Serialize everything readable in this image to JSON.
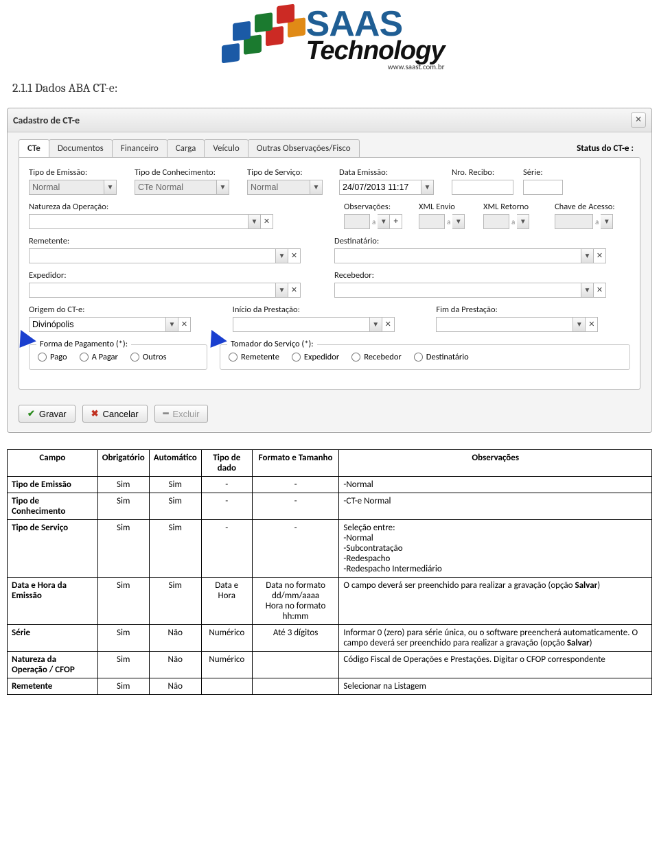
{
  "logo": {
    "saas": "SAAS",
    "tech": "Technology",
    "url": "www.saast.com.br"
  },
  "section_heading": "2.1.1 Dados ABA CT-e:",
  "window": {
    "title": "Cadastro de CT-e",
    "status_label": "Status do CT-e :",
    "tabs": [
      {
        "label": "CTe",
        "active": true
      },
      {
        "label": "Documentos",
        "active": false
      },
      {
        "label": "Financeiro",
        "active": false
      },
      {
        "label": "Carga",
        "active": false
      },
      {
        "label": "Veículo",
        "active": false
      },
      {
        "label": "Outras Observações/Fisco",
        "active": false
      }
    ],
    "row1": {
      "tipo_emissao": {
        "label": "Tipo de Emissão:",
        "value": "Normal"
      },
      "tipo_conhecimento": {
        "label": "Tipo de Conhecimento:",
        "value": "CTe Normal"
      },
      "tipo_servico": {
        "label": "Tipo de Serviço:",
        "value": "Normal"
      },
      "data_emissao": {
        "label": "Data Emissão:",
        "value": "24/07/2013 11:17"
      },
      "nro_recibo": {
        "label": "Nro. Recibo:",
        "value": ""
      },
      "serie": {
        "label": "Série:",
        "value": ""
      }
    },
    "row2": {
      "natureza": {
        "label": "Natureza da Operação:",
        "value": ""
      },
      "observacoes": {
        "label": "Observações:",
        "value": ""
      },
      "xml_envio": {
        "label": "XML Envio",
        "value": ""
      },
      "xml_retorno": {
        "label": "XML Retorno",
        "value": ""
      },
      "chave_acesso": {
        "label": "Chave de Acesso:",
        "value": ""
      }
    },
    "row3": {
      "remetente": {
        "label": "Remetente:",
        "value": ""
      },
      "destinatario": {
        "label": "Destinatário:",
        "value": ""
      }
    },
    "row4": {
      "expedidor": {
        "label": "Expedidor:",
        "value": ""
      },
      "recebedor": {
        "label": "Recebedor:",
        "value": ""
      }
    },
    "row5": {
      "origem": {
        "label": "Origem do CT-e:",
        "value": "Divinópolis"
      },
      "inicio": {
        "label": "Início da Prestação:",
        "value": ""
      },
      "fim": {
        "label": "Fim da Prestação:",
        "value": ""
      }
    },
    "group_pagamento": {
      "legend": "Forma de Pagamento (*):",
      "options": [
        "Pago",
        "A Pagar",
        "Outros"
      ]
    },
    "group_tomador": {
      "legend": "Tomador do Serviço (*):",
      "options": [
        "Remetente",
        "Expedidor",
        "Recebedor",
        "Destinatário"
      ]
    },
    "buttons": {
      "gravar": "Gravar",
      "cancelar": "Cancelar",
      "excluir": "Excluir"
    }
  },
  "table": {
    "headers": [
      "Campo",
      "Obrigatório",
      "Automático",
      "Tipo de dado",
      "Formato e Tamanho",
      "Observações"
    ],
    "rows": [
      {
        "campo": "Tipo de Emissão",
        "obrig": "Sim",
        "auto": "Sim",
        "tipo": "-",
        "formato": "-",
        "obs": "-Normal"
      },
      {
        "campo": "Tipo de Conhecimento",
        "obrig": "Sim",
        "auto": "Sim",
        "tipo": "-",
        "formato": "-",
        "obs": "-CT-e Normal"
      },
      {
        "campo": "Tipo de Serviço",
        "obrig": "Sim",
        "auto": "Sim",
        "tipo": "-",
        "formato": "-",
        "obs": "Seleção entre:\n -Normal\n -Subcontratação\n -Redespacho\n -Redespacho Intermediário"
      },
      {
        "campo": "Data e Hora da Emissão",
        "obrig": "Sim",
        "auto": "Sim",
        "tipo": "Data e Hora",
        "formato": "Data no formato dd/mm/aaaa\nHora no formato hh:mm",
        "obs": "O campo deverá ser preenchido para realizar a gravação (opção Salvar)",
        "obs_bold": "Salvar"
      },
      {
        "campo": "Série",
        "obrig": "Sim",
        "auto": "Não",
        "tipo": "Numérico",
        "formato": "Até 3 dígitos",
        "obs": "Informar 0 (zero) para série única, ou o software preencherá automaticamente. O campo deverá ser preenchido para realizar a gravação (opção Salvar)",
        "obs_bold": "Salvar"
      },
      {
        "campo": "Natureza da Operação / CFOP",
        "obrig": "Sim",
        "auto": "Não",
        "tipo": "Numérico",
        "formato": "",
        "obs": "Código Fiscal de Operações e Prestações. Digitar o CFOP correspondente"
      },
      {
        "campo": "Remetente",
        "obrig": "Sim",
        "auto": "Não",
        "tipo": "",
        "formato": "",
        "obs": "Selecionar na Listagem"
      }
    ]
  }
}
